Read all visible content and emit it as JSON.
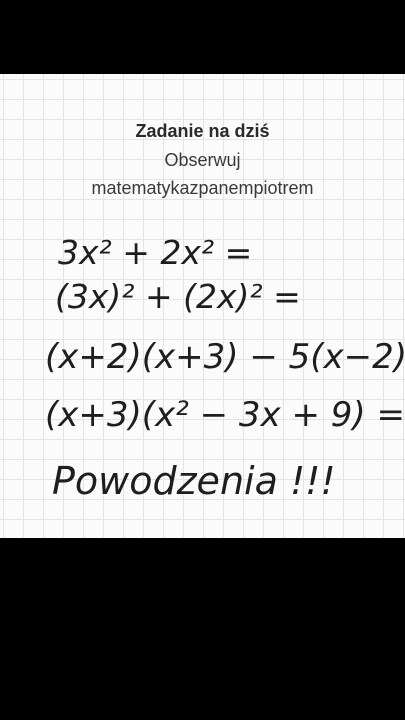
{
  "header": {
    "title": "Zadanie na dziś",
    "subtitle": "Obserwuj",
    "handle": "matematykazpanempiotrem"
  },
  "equations": [
    "3x² + 2x² =",
    "(3x)² + (2x)² =",
    "(x+2)(x+3) − 5(x−2) =",
    "(x+3)(x² − 3x + 9) ="
  ],
  "closing": "Powodzenia !!!"
}
